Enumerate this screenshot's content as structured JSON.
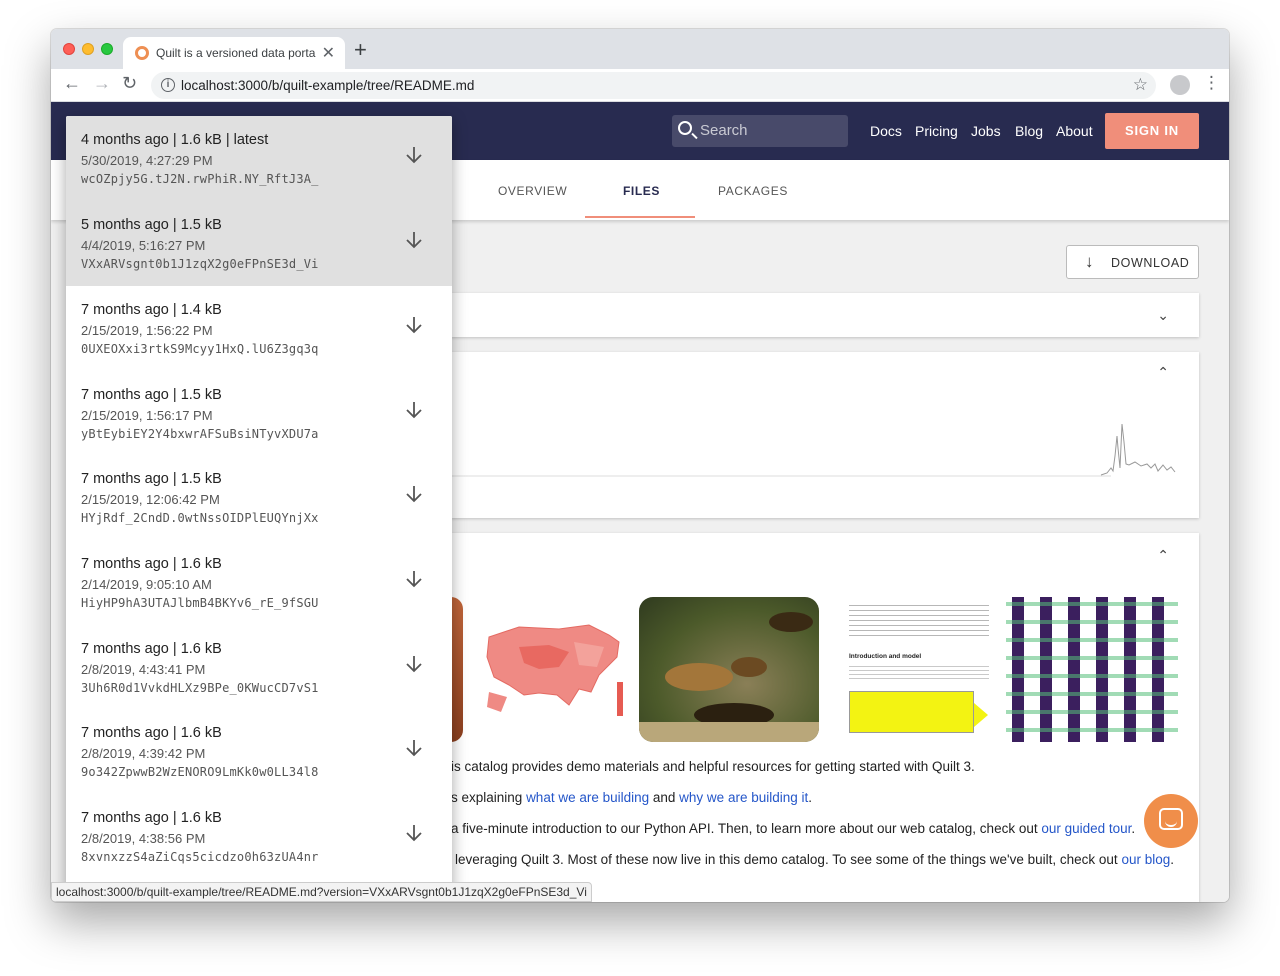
{
  "browser": {
    "tab_title": "Quilt is a versioned data portal",
    "url": "localhost:3000/b/quilt-example/tree/README.md",
    "status_url": "localhost:3000/b/quilt-example/tree/README.md?version=VXxARVsgnt0b1J1zqX2g0eFPnSE3d_Vi"
  },
  "header": {
    "search_placeholder": "Search",
    "nav": [
      "Docs",
      "Pricing",
      "Jobs",
      "Blog",
      "About"
    ],
    "signin_label": "SIGN IN",
    "brand_color": "#282b50",
    "accent_color": "#f08e7a"
  },
  "page_tabs": [
    "OVERVIEW",
    "FILES",
    "PACKAGES"
  ],
  "active_tab": "FILES",
  "download_label": "DOWNLOAD",
  "versions": [
    {
      "summary": "4 months ago | 1.6 kB | latest",
      "date": "5/30/2019, 4:27:29 PM",
      "version_id": "wcOZpjy5G.tJ2N.rwPhiR.NY_RftJ3A_"
    },
    {
      "summary": "5 months ago | 1.5 kB",
      "date": "4/4/2019, 5:16:27 PM",
      "version_id": "VXxARVsgnt0b1J1zqX2g0eFPnSE3d_Vi"
    },
    {
      "summary": "7 months ago | 1.4 kB",
      "date": "2/15/2019, 1:56:22 PM",
      "version_id": "0UXEOXxi3rtkS9Mcyy1HxQ.lU6Z3gq3q"
    },
    {
      "summary": "7 months ago | 1.5 kB",
      "date": "2/15/2019, 1:56:17 PM",
      "version_id": "yBtEybiEY2Y4bxwrAFSuBsiNTyvXDU7a"
    },
    {
      "summary": "7 months ago | 1.5 kB",
      "date": "2/15/2019, 12:06:42 PM",
      "version_id": "HYjRdf_2CndD.0wtNssOIDPlEUQYnjXx"
    },
    {
      "summary": "7 months ago | 1.6 kB",
      "date": "2/14/2019, 9:05:10 AM",
      "version_id": "HiyHP9hA3UTAJlbmB4BKYv6_rE_9fSGU"
    },
    {
      "summary": "7 months ago | 1.6 kB",
      "date": "2/8/2019, 4:43:41 PM",
      "version_id": "3Uh6R0d1VvkdHLXz9BPe_0KWucCD7vS1"
    },
    {
      "summary": "7 months ago | 1.6 kB",
      "date": "2/8/2019, 4:39:42 PM",
      "version_id": "9o342ZpwwB2WzENORO9LmKk0w0LL34l8"
    },
    {
      "summary": "7 months ago | 1.6 kB",
      "date": "2/8/2019, 4:38:56 PM",
      "version_id": "8xvnxzzS4aZiCqs5cicdzo0h63zUA4nr"
    }
  ],
  "readme": {
    "line1": "is catalog provides demo materials and helpful resources for getting started with Quilt 3.",
    "line2_pre": "s explaining ",
    "line2_link1": "what we are building",
    "line2_mid": " and ",
    "line2_link2": "why we are building it",
    "line2_post": ".",
    "line3_pre": "a five-minute introduction to our Python API. Then, to learn more about our web catalog, check out ",
    "line3_link": "our guided tour",
    "line3_post": ".",
    "line4_pre": "leveraging Quilt 3. Most of these now live in this demo catalog. To see some of the things we've built, check out ",
    "line4_link": "our blog",
    "line4_post": "."
  },
  "notebook_thumb": {
    "heading": "Introduction and model"
  }
}
